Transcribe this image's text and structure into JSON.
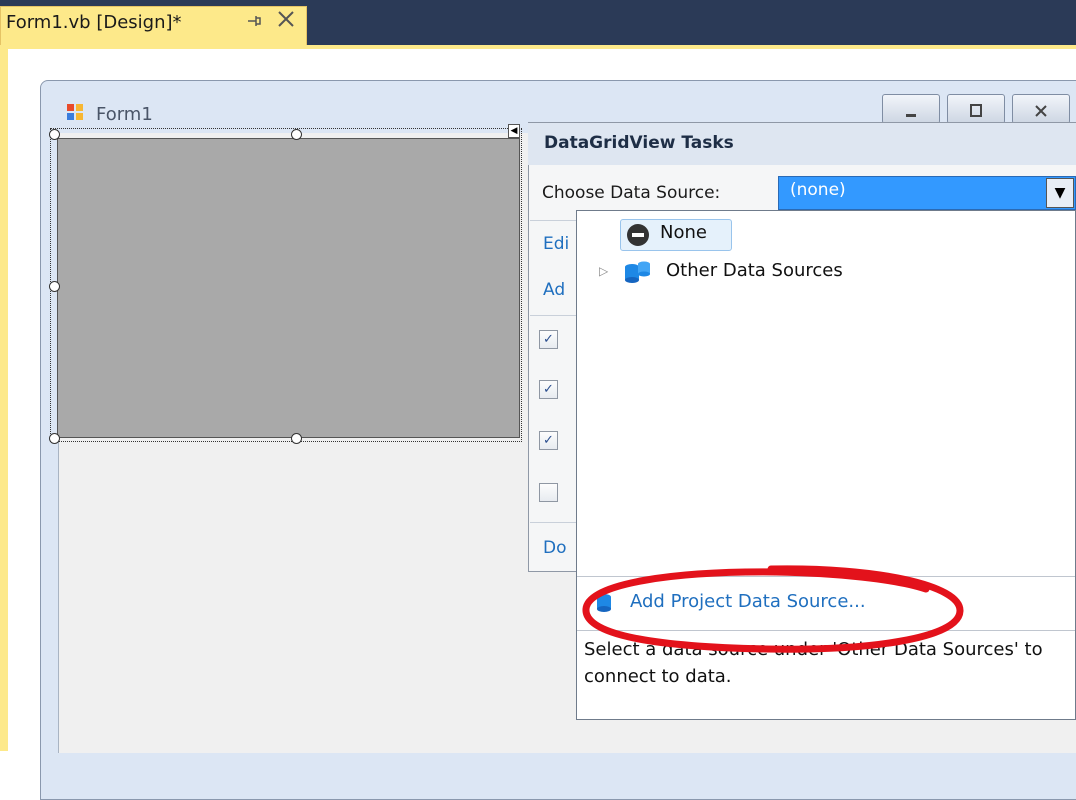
{
  "tab": {
    "title": "Form1.vb [Design]*",
    "pin_icon": "pin-icon",
    "close_icon": "close-icon"
  },
  "form": {
    "title": "Form1",
    "icon": "form-icon",
    "caption_buttons": [
      "minimize",
      "maximize",
      "close"
    ]
  },
  "tasks_panel": {
    "title": "DataGridView Tasks",
    "choose_label": "Choose Data Source:",
    "selected_value": "(none)",
    "links": [
      "Edi",
      "Ad",
      "Do"
    ],
    "checkboxes": [
      {
        "checked": true
      },
      {
        "checked": true
      },
      {
        "checked": true
      },
      {
        "checked": false
      }
    ]
  },
  "dropdown": {
    "none_label": "None",
    "other_label": "Other Data Sources",
    "add_label": "Add Project Data Source...",
    "description": "Select a data source under 'Other Data Sources' to connect to data."
  },
  "colors": {
    "tab_active": "#fde98a",
    "title_bar": "#2b3a57",
    "selection": "#3399ff",
    "link": "#1f6fbf",
    "annotation": "#e3121b"
  }
}
